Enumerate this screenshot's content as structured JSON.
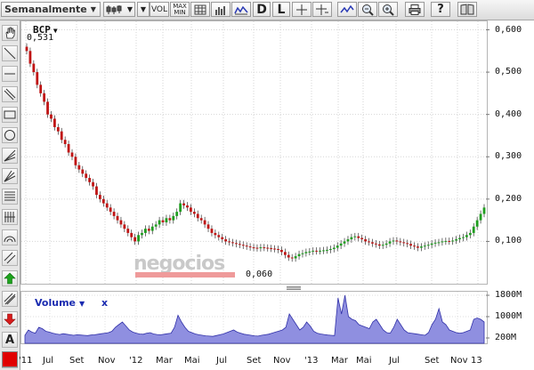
{
  "toolbar": {
    "period_select": "Semanalmente",
    "vol_label": "VOL",
    "maxmin_top": "MAX",
    "maxmin_bottom": "MIN",
    "d_label": "D",
    "l_label": "L"
  },
  "chart": {
    "ticker": "BCP",
    "last_value": "0,531",
    "min_value": "0,060",
    "watermark": "negocios",
    "volume_title": "Volume",
    "volume_close": "x"
  },
  "chart_data": [
    {
      "type": "candlestick",
      "y_ticks": [
        "0,600",
        "0,500",
        "0,400",
        "0,300",
        "0,200",
        "0,100"
      ],
      "ylim": [
        0.0,
        0.62
      ],
      "x_ticks": [
        "'11",
        "Jul",
        "Set",
        "Nov",
        "'12",
        "Mar",
        "Mai",
        "Jul",
        "Set",
        "Nov",
        "'13",
        "Mar",
        "Mai",
        "Jul",
        "Set",
        "Nov",
        "13"
      ],
      "grid": true,
      "annotations": [
        "0,531",
        "0,060"
      ],
      "close_series": [
        0.55,
        0.52,
        0.5,
        0.47,
        0.45,
        0.43,
        0.4,
        0.39,
        0.37,
        0.36,
        0.34,
        0.33,
        0.31,
        0.3,
        0.28,
        0.27,
        0.26,
        0.25,
        0.24,
        0.23,
        0.21,
        0.2,
        0.19,
        0.18,
        0.17,
        0.16,
        0.15,
        0.14,
        0.13,
        0.12,
        0.11,
        0.1,
        0.115,
        0.12,
        0.13,
        0.125,
        0.135,
        0.14,
        0.15,
        0.145,
        0.155,
        0.15,
        0.16,
        0.17,
        0.19,
        0.185,
        0.18,
        0.17,
        0.165,
        0.155,
        0.15,
        0.14,
        0.13,
        0.12,
        0.115,
        0.11,
        0.105,
        0.1,
        0.098,
        0.096,
        0.094,
        0.092,
        0.09,
        0.088,
        0.086,
        0.085,
        0.084,
        0.086,
        0.085,
        0.084,
        0.083,
        0.082,
        0.08,
        0.075,
        0.068,
        0.062,
        0.06,
        0.065,
        0.07,
        0.072,
        0.075,
        0.076,
        0.078,
        0.077,
        0.078,
        0.079,
        0.08,
        0.082,
        0.085,
        0.09,
        0.095,
        0.1,
        0.105,
        0.11,
        0.112,
        0.108,
        0.105,
        0.1,
        0.098,
        0.095,
        0.093,
        0.09,
        0.092,
        0.095,
        0.1,
        0.102,
        0.1,
        0.098,
        0.096,
        0.094,
        0.09,
        0.088,
        0.085,
        0.088,
        0.09,
        0.092,
        0.095,
        0.097,
        0.098,
        0.1,
        0.101,
        0.1,
        0.102,
        0.105,
        0.108,
        0.11,
        0.115,
        0.12,
        0.135,
        0.15,
        0.165,
        0.18
      ]
    },
    {
      "type": "area",
      "series": [
        {
          "name": "Volume",
          "values": [
            300,
            500,
            420,
            380,
            600,
            550,
            450,
            420,
            380,
            350,
            330,
            360,
            340,
            320,
            300,
            320,
            310,
            300,
            290,
            310,
            320,
            340,
            360,
            380,
            400,
            450,
            600,
            700,
            800,
            650,
            500,
            420,
            380,
            350,
            340,
            380,
            400,
            350,
            330,
            320,
            340,
            360,
            380,
            600,
            1050,
            800,
            600,
            450,
            400,
            350,
            320,
            300,
            280,
            270,
            260,
            290,
            320,
            350,
            400,
            450,
            500,
            420,
            380,
            340,
            320,
            300,
            280,
            270,
            300,
            320,
            340,
            380,
            420,
            460,
            500,
            600,
            1100,
            900,
            700,
            500,
            600,
            800,
            650,
            450,
            380,
            350,
            330,
            310,
            300,
            290,
            1700,
            1100,
            1800,
            1000,
            900,
            850,
            700,
            650,
            600,
            550,
            800,
            900,
            700,
            500,
            400,
            380,
            600,
            900,
            700,
            500,
            400,
            380,
            360,
            340,
            320,
            300,
            400,
            700,
            900,
            1300,
            800,
            700,
            500,
            450,
            400,
            380,
            400,
            450,
            500,
            900,
            950,
            900,
            800
          ]
        }
      ],
      "y_ticks": [
        "1800M",
        "1000M",
        "200M"
      ],
      "ylim": [
        0,
        1900
      ]
    }
  ]
}
